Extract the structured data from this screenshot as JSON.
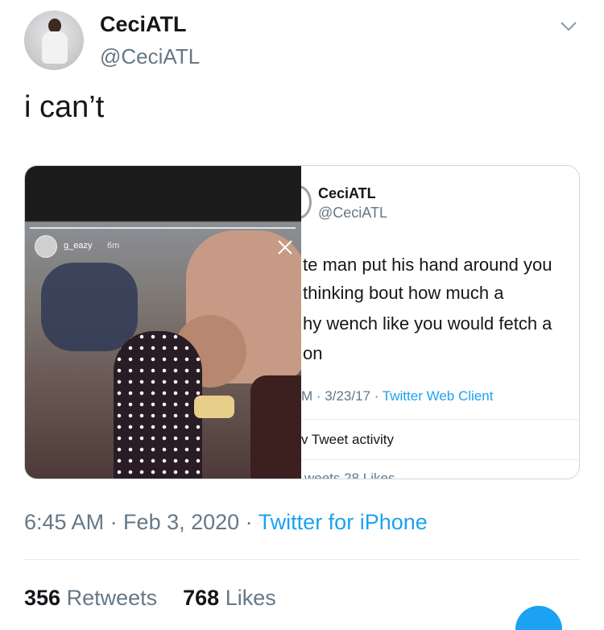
{
  "header": {
    "display_name": "CeciATL",
    "handle": "@CeciATL"
  },
  "tweet": {
    "text": "i can’t"
  },
  "story": {
    "username": "g_eazy",
    "time": "6m"
  },
  "screenshot_tweet": {
    "display_name": "CeciATL",
    "handle": "@CeciATL",
    "lines": [
      "te man put his hand around you",
      " thinking bout how much a",
      "hy wench like you would fetch a",
      "on"
    ],
    "meta_time": "M · 3/23/17 · ",
    "meta_client": "Twitter Web Client",
    "activity": "v Tweet activity",
    "cut_text": "weets  28 Likes"
  },
  "footer": {
    "time_date": "6:45 AM · Feb 3, 2020 · ",
    "source": "Twitter for iPhone",
    "retweet_count": "356",
    "retweet_label": "Retweets",
    "like_count": "768",
    "like_label": "Likes"
  },
  "colors": {
    "link": "#1da1f2",
    "secondary_text": "#657786",
    "primary_text": "#14171a"
  },
  "icons": [
    "chevron-down-icon",
    "close-icon"
  ]
}
